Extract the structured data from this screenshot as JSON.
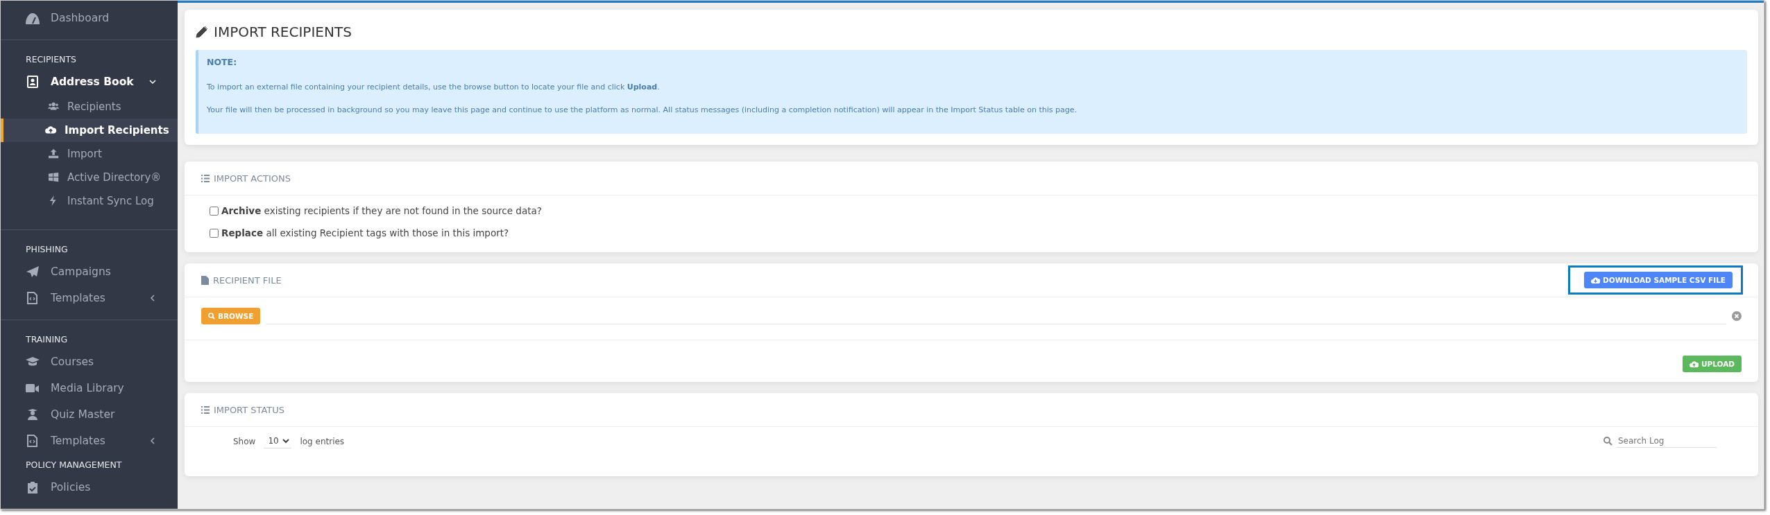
{
  "sidebar": {
    "items": [
      {
        "kind": "item",
        "label": "Dashboard",
        "selected": false
      },
      {
        "kind": "divider"
      },
      {
        "kind": "header",
        "label": "RECIPIENTS"
      },
      {
        "kind": "item",
        "label": "Address Book",
        "selected": false,
        "expanded": true,
        "children": [
          {
            "label": "Recipients",
            "selected": false
          },
          {
            "label": "Import Recipients",
            "selected": true
          },
          {
            "label": "Import",
            "selected": false
          },
          {
            "label": "Active Directory®",
            "selected": false
          },
          {
            "label": "Instant Sync Log",
            "selected": false
          }
        ]
      },
      {
        "kind": "divider"
      },
      {
        "kind": "header",
        "label": "PHISHING"
      },
      {
        "kind": "item",
        "label": "Campaigns",
        "selected": false
      },
      {
        "kind": "item",
        "label": "Templates",
        "selected": false,
        "expanded": false
      },
      {
        "kind": "divider"
      },
      {
        "kind": "header",
        "label": "TRAINING"
      },
      {
        "kind": "item",
        "label": "Courses",
        "selected": false
      },
      {
        "kind": "item",
        "label": "Media Library",
        "selected": false
      },
      {
        "kind": "item",
        "label": "Quiz Master",
        "selected": false
      },
      {
        "kind": "item",
        "label": "Templates",
        "selected": false,
        "expanded": false
      },
      {
        "kind": "header",
        "label": "POLICY MANAGEMENT"
      },
      {
        "kind": "item",
        "label": "Policies",
        "selected": false
      }
    ]
  },
  "page": {
    "title": "IMPORT RECIPIENTS",
    "note": {
      "heading": "NOTE:",
      "paragraphs": [
        "To import an external file containing your recipient details, use the browse button to locate your file and click **Upload**.",
        "Your file will then be processed in background so you may leave this page and continue to use the platform as normal. All status messages (including a completion notification) will appear in the Import Status table on this page."
      ]
    }
  },
  "import_actions": {
    "title": "IMPORT ACTIONS",
    "options": [
      {
        "label": "**Archive** existing recipients if they are not found in the source data?",
        "checked": false
      },
      {
        "label": "**Replace** all existing Recipient tags with those in this import?",
        "checked": false
      }
    ]
  },
  "recipient_file": {
    "title": "RECIPIENT FILE",
    "download_button": "DOWNLOAD SAMPLE CSV FILE",
    "download_highlighted": true,
    "browse_button": "BROWSE",
    "upload_button": "UPLOAD"
  },
  "import_status": {
    "title": "IMPORT STATUS",
    "show_label": "Show",
    "page_size": "10",
    "entries_label": "log entries",
    "search": {
      "placeholder": "Search Log"
    }
  }
}
